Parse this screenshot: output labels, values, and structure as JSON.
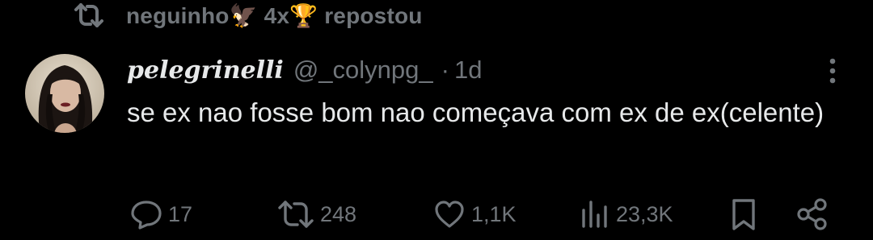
{
  "repost": {
    "label": "neguinho🦅 4x🏆 repostou"
  },
  "post": {
    "display_name": "pelegrinelli",
    "handle": "@_colynpg_",
    "separator": "·",
    "time": "1d",
    "text": "se ex nao fosse bom nao começava com ex de ex(celente)"
  },
  "actions": {
    "replies": "17",
    "reposts": "248",
    "likes": "1,1K",
    "views": "23,3K"
  },
  "colors": {
    "background": "#000000",
    "primary_text": "#e7e9ea",
    "secondary_text": "#71767b"
  },
  "icons": [
    "repost-icon",
    "more-icon",
    "reply-icon",
    "repost-icon",
    "like-icon",
    "views-icon",
    "bookmark-icon",
    "share-icon"
  ]
}
